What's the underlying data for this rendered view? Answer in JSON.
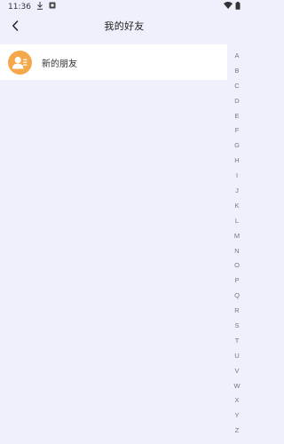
{
  "status_bar": {
    "time": "11:36",
    "left_icons": [
      "download-icon",
      "notification-icon"
    ],
    "right_icons": [
      "wifi-icon",
      "battery-icon"
    ]
  },
  "header": {
    "title": "我的好友",
    "back_icon": "chevron-left-icon"
  },
  "list": {
    "items": [
      {
        "label": "新的朋友",
        "icon": "add-friend-icon",
        "icon_color": "#f5a84a"
      }
    ]
  },
  "alpha_index": [
    "A",
    "B",
    "C",
    "D",
    "E",
    "F",
    "G",
    "H",
    "I",
    "J",
    "K",
    "L",
    "M",
    "N",
    "O",
    "P",
    "Q",
    "R",
    "S",
    "T",
    "U",
    "V",
    "W",
    "X",
    "Y",
    "Z"
  ],
  "colors": {
    "background": "#eef1fc",
    "accent": "#f5a84a",
    "list_bg": "#ffffff"
  }
}
